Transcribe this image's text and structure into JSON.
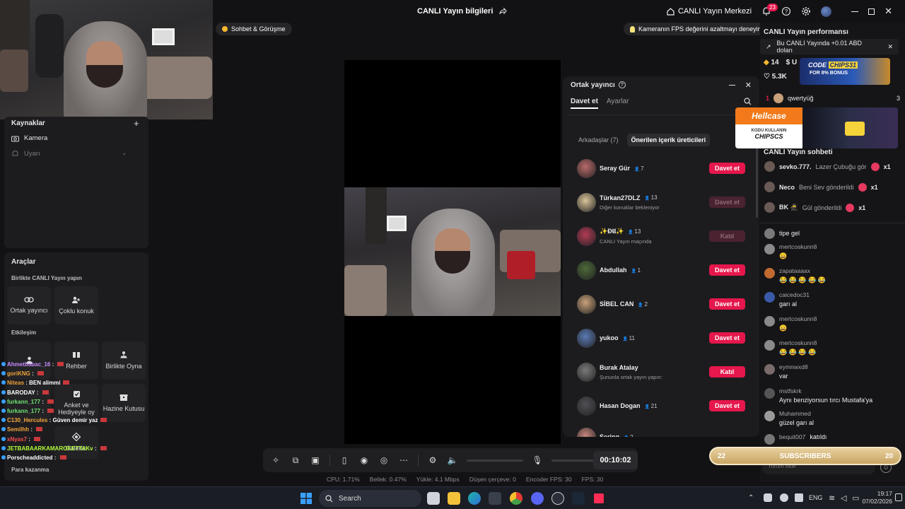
{
  "titlebar": {
    "title": "CANLI Yayın bilgileri",
    "live_center": "CANLI Yayın Merkezi",
    "notif_count": "23"
  },
  "pills": {
    "chat_pill": "Sohbet & Görüşme",
    "fps_tip": "Kameranın FPS değerini azaltmayı deneyin"
  },
  "sources": {
    "title": "Kaynaklar",
    "items": [
      {
        "label": "Kamera"
      },
      {
        "label": "Uyarı"
      }
    ]
  },
  "tools": {
    "title": "Araçlar",
    "section1": "Birlikte CANLI Yayın yapın",
    "btn_cohost": "Ortak yayıncı",
    "btn_multi": "Çoklu konuk",
    "section2": "Etkileşim",
    "btn_guide": "Rehber",
    "btn_play": "Birlikte Oyna",
    "btn_poll": "Anket ve Hediyeyle oy",
    "btn_treasure": "Hazine Kutusu",
    "btn_gallery": "Galerisi",
    "section3": "Para kazanma"
  },
  "left_chat": [
    {
      "name": "Ahmetbabac_16",
      "text": "",
      "color": "#c98cff"
    },
    {
      "name": "goriKNG",
      "text": "",
      "color": "#f2a33a"
    },
    {
      "name": "Niteas",
      "text": "BEN alimmi",
      "color": "#f2a33a"
    },
    {
      "name": "BARODAY",
      "text": "",
      "color": "#ffffff"
    },
    {
      "name": "furkann_177",
      "text": "",
      "color": "#6ee56e"
    },
    {
      "name": "furkann_177",
      "text": "",
      "color": "#6ee56e"
    },
    {
      "name": "C130_Hercules",
      "text": "Güven demir yaz",
      "color": "#f2a33a"
    },
    {
      "name": "Semilhh",
      "text": "",
      "color": "#f2a33a"
    },
    {
      "name": "xNyas7",
      "text": "",
      "color": "#ff4d4d"
    },
    {
      "name": "JETBABAARKAMAROKETTAKv",
      "text": "",
      "color": "#b5ff3a"
    },
    {
      "name": "Porscheaddicted",
      "text": "",
      "color": "#ffffff"
    }
  ],
  "controls": {
    "timer": "00:10:02"
  },
  "stats": {
    "cpu": "CPU: 1.71%",
    "mem": "Bellek: 0.47%",
    "upload": "Yükle: 4.1 Mbps",
    "drop": "Düşen çerçeve: 0",
    "enc": "Encoder FPS: 30",
    "fps": "FPS: 30"
  },
  "cohost": {
    "title": "Ortak yayıncı",
    "tab_invite": "Davet et",
    "tab_settings": "Ayarlar",
    "sub_friends": "Arkadaşlar (7)",
    "sub_suggested": "Önerilen içerik üreticileri",
    "users": [
      {
        "name": "Seray Gür",
        "count": "7",
        "sub": "",
        "btn": "Davet et",
        "state": "active",
        "color": "#b96a6a"
      },
      {
        "name": "Türkan27DLZ",
        "count": "13",
        "sub": "Diğer konuklar bekleniyor",
        "btn": "Davet et",
        "state": "dim",
        "color": "#d9c49a"
      },
      {
        "name": "✨Đ𝖎𝖑✨",
        "count": "13",
        "sub": "CANLI Yayın maçında",
        "btn": "Katıl",
        "state": "dim",
        "color": "#b23a55"
      },
      {
        "name": "Abdullah",
        "count": "1",
        "sub": "",
        "btn": "Davet et",
        "state": "active",
        "color": "#4d6a3a"
      },
      {
        "name": "SİBEL CAN",
        "count": "2",
        "sub": "",
        "btn": "Davet et",
        "state": "active",
        "color": "#c9a27a"
      },
      {
        "name": "yukoo",
        "count": "11",
        "sub": "",
        "btn": "Davet et",
        "state": "active",
        "color": "#5a7ab5"
      },
      {
        "name": "Burak Atalay",
        "count": "",
        "sub": "Şununla ortak yayın yapın:",
        "btn": "Katıl",
        "state": "active",
        "color": "#7a7a7a"
      },
      {
        "name": "Hasan Dogan",
        "count": "21",
        "sub": "",
        "btn": "Davet et",
        "state": "active",
        "color": "#505055"
      },
      {
        "name": "Sering",
        "count": "2",
        "sub": "",
        "btn": "",
        "state": "active",
        "color": "#c4847a"
      }
    ]
  },
  "right_panel": {
    "perf_title": "CANLI Yayın performansı",
    "earn_banner": "Bu CANLI Yayında +0.01 ABD doları",
    "stat_diamonds": "14",
    "stat_u": "U",
    "stat_likes": "5.3K",
    "sponsor_code": "CODE",
    "sponsor_chip": "CHIPS31",
    "sponsor_bonus": "FOR 8% BONUS",
    "ranking": {
      "rank": "1",
      "name": "qwertyüğ",
      "score": "3"
    },
    "hellcase": "Hellcase",
    "hellcase_sub": "KODU KULLANIN",
    "hellcase_code": "CHIPSCS",
    "chat_title": "CANLI Yayın sohbeti",
    "gifts": [
      {
        "user": "sevko.777.",
        "text": "Lazer Çubuğu gör",
        "mult": "x1"
      },
      {
        "user": "Neco",
        "text": "Beni Sev gönderildi",
        "mult": "x1"
      },
      {
        "user": "BK 🥷",
        "text": "Gül gönderildi",
        "mult": "x1"
      }
    ],
    "messages": [
      {
        "name": "",
        "text": "tipe gel"
      },
      {
        "name": "mertcoskunn8",
        "text": "😀"
      },
      {
        "name": "zapataaaax",
        "text": "😂 😂 😂 😂 😂"
      },
      {
        "name": "caicedoc31",
        "text": "garı al"
      },
      {
        "name": "mertcoskunn8",
        "text": "😀"
      },
      {
        "name": "mertcoskunn8",
        "text": "😂 😂 😂 😂"
      },
      {
        "name": "eymnwxd8",
        "text": "var"
      },
      {
        "name": "mstfskrk",
        "text": "Aynı benziyorsun tırcı Mustafa'ya"
      },
      {
        "name": "Muhammed",
        "text": "güzel garı al"
      },
      {
        "name": "bequit007",
        "text": "katıldı"
      }
    ],
    "comment_placeholder": "Yorum ekle"
  },
  "subs_bar": {
    "left": "22",
    "label": "SUBSCRIBERS",
    "right": "20"
  },
  "taskbar": {
    "search": "Search",
    "lang": "ENG",
    "time": "19:17",
    "date": "07/02/2026"
  }
}
